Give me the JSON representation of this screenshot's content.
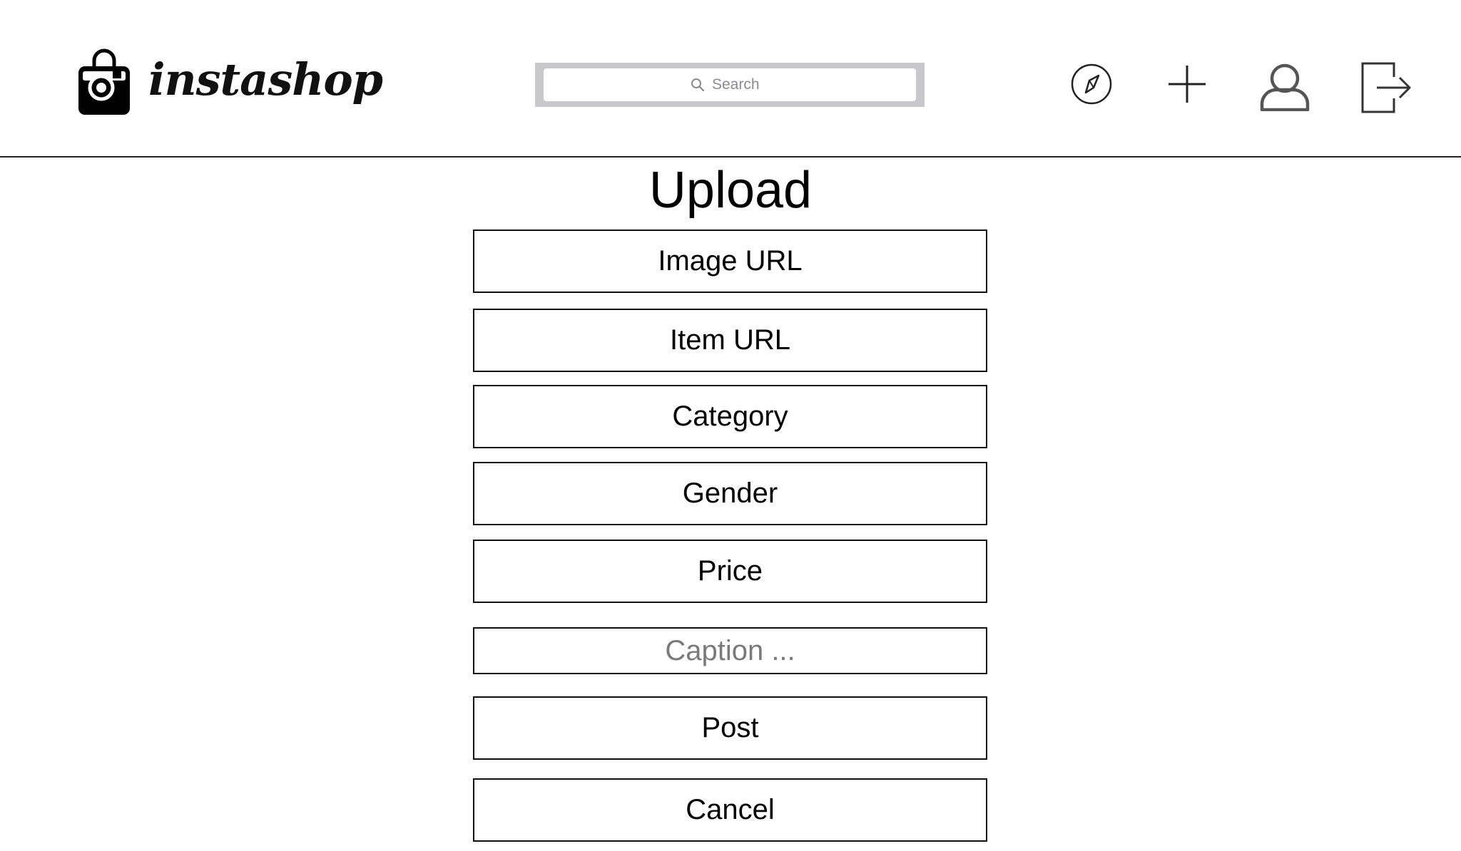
{
  "app": {
    "brand_name": "instashop",
    "logo_icon": "shopping-bag-camera-icon"
  },
  "search": {
    "placeholder": "Search",
    "icon": "search-icon"
  },
  "nav": {
    "explore_icon": "compass-icon",
    "add_icon": "plus-icon",
    "profile_icon": "user-icon",
    "logout_icon": "logout-icon"
  },
  "upload": {
    "title": "Upload",
    "fields": {
      "image_url": "Image URL",
      "item_url": "Item URL",
      "category": "Category",
      "gender": "Gender",
      "price": "Price",
      "caption_placeholder": "Caption ..."
    },
    "post_label": "Post",
    "cancel_label": "Cancel"
  },
  "colors": {
    "border": "#111111",
    "search_frame": "#c8c8cc",
    "placeholder_text": "#7a7a7a"
  }
}
